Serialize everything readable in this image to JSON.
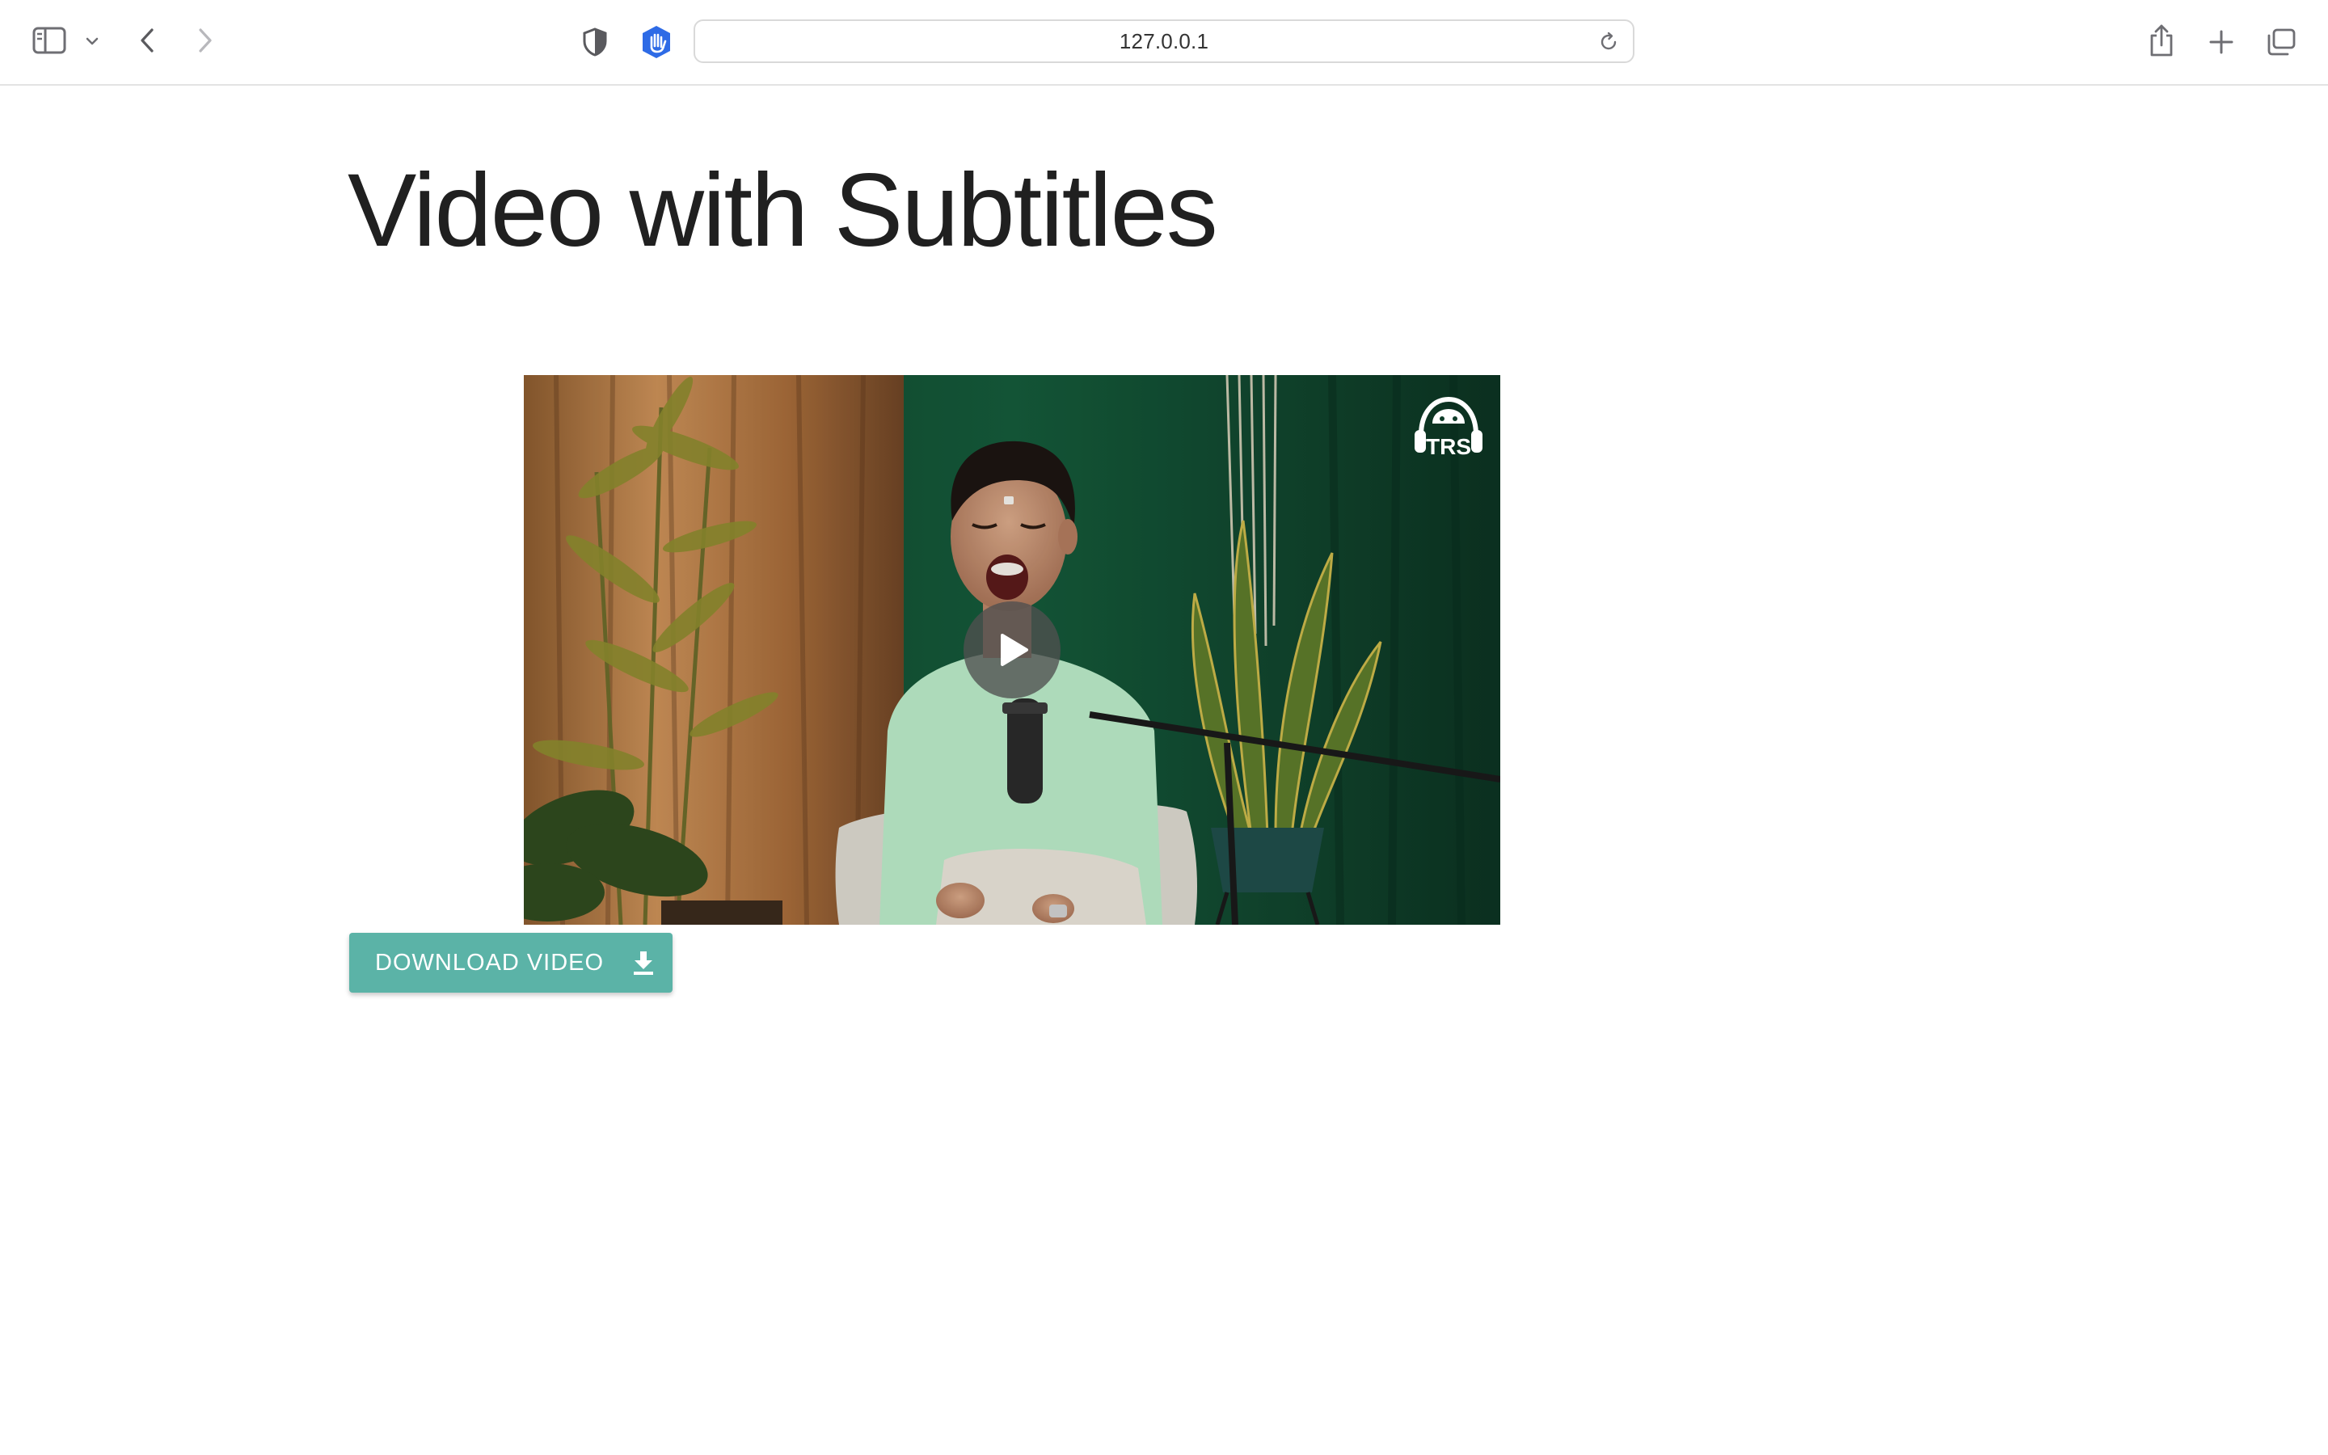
{
  "browser": {
    "url": "127.0.0.1",
    "icons": {
      "sidebar": "sidebar-icon",
      "tab_group_menu": "chevron-down-icon",
      "back": "back-arrow-icon",
      "forward": "forward-arrow-icon",
      "privacy": "privacy-shield-icon",
      "extension": "hand-blocker-icon",
      "reload": "reload-icon",
      "share": "share-icon",
      "new_tab": "plus-icon",
      "tab_overview": "tabs-icon"
    }
  },
  "page": {
    "title": "Video with Subtitles"
  },
  "video": {
    "logo_text": "TRS",
    "play_icon": "play-icon"
  },
  "download": {
    "label": "DOWNLOAD VIDEO",
    "icon": "download-icon",
    "color": "#5bb3a7"
  }
}
